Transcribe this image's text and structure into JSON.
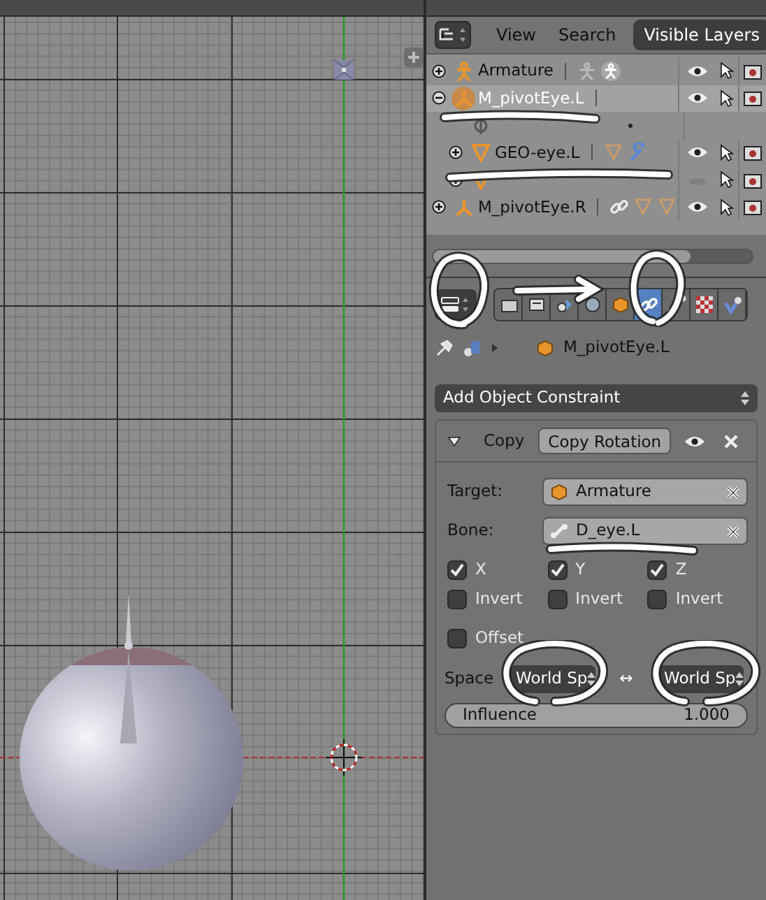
{
  "outliner": {
    "header": {
      "menus": [
        "View",
        "Search"
      ],
      "display_mode": "Visible Layers"
    },
    "items": [
      {
        "label": "Armature",
        "kind": "armature",
        "expanded": false,
        "selected": false,
        "visible": true,
        "icons": [
          {
            "kind": "pose"
          },
          {
            "kind": "armature-data"
          }
        ]
      },
      {
        "label": "M_pivotEye.L",
        "kind": "empty",
        "expanded": true,
        "selected": true,
        "visible": true,
        "children": [
          {
            "kind": "constraints",
            "icons": [
              {
                "kind": "dot"
              }
            ]
          },
          {
            "label": "GEO-eye.L",
            "kind": "mesh",
            "expanded": false,
            "selected": false,
            "visible": true,
            "icons": [
              {
                "kind": "mesh-data"
              },
              {
                "kind": "wrench"
              }
            ]
          },
          {
            "kind": "mesh",
            "expanded": false,
            "selected": false,
            "visible": false
          }
        ]
      },
      {
        "label": "M_pivotEye.R",
        "kind": "empty",
        "expanded": false,
        "selected": false,
        "visible": true,
        "icons": [
          {
            "kind": "link"
          },
          {
            "kind": "mesh-data"
          },
          {
            "kind": "mesh-data"
          }
        ]
      }
    ]
  },
  "properties": {
    "tabs": [
      {
        "kind": "render",
        "selected": false
      },
      {
        "kind": "layers",
        "selected": false
      },
      {
        "kind": "scene",
        "selected": false
      },
      {
        "kind": "world",
        "selected": false
      },
      {
        "kind": "object",
        "selected": false
      },
      {
        "kind": "constraint",
        "selected": true
      },
      {
        "kind": "data",
        "selected": false
      },
      {
        "kind": "texture",
        "selected": false
      },
      {
        "kind": "physics",
        "selected": false
      }
    ],
    "breadcrumb": "M_pivotEye.L",
    "add_menu": "Add Object Constraint",
    "constraint": {
      "expanded": true,
      "name": "Copy",
      "type": "Copy Rotation",
      "target_label": "Target:",
      "target": "Armature",
      "bone_label": "Bone:",
      "bone": "D_eye.L",
      "axes": [
        {
          "label": "X",
          "checked": true
        },
        {
          "label": "Y",
          "checked": true
        },
        {
          "label": "Z",
          "checked": true
        }
      ],
      "inverts": [
        {
          "label": "Invert",
          "checked": false
        },
        {
          "label": "Invert",
          "checked": false
        },
        {
          "label": "Invert",
          "checked": false
        }
      ],
      "offset": {
        "label": "Offset",
        "checked": false
      },
      "space_label": "Space",
      "owner_space": "World Sp",
      "swap": "↔",
      "target_space": "World Sp",
      "influence": {
        "label": "Influence",
        "reading": "1.000",
        "level": 1
      }
    }
  }
}
